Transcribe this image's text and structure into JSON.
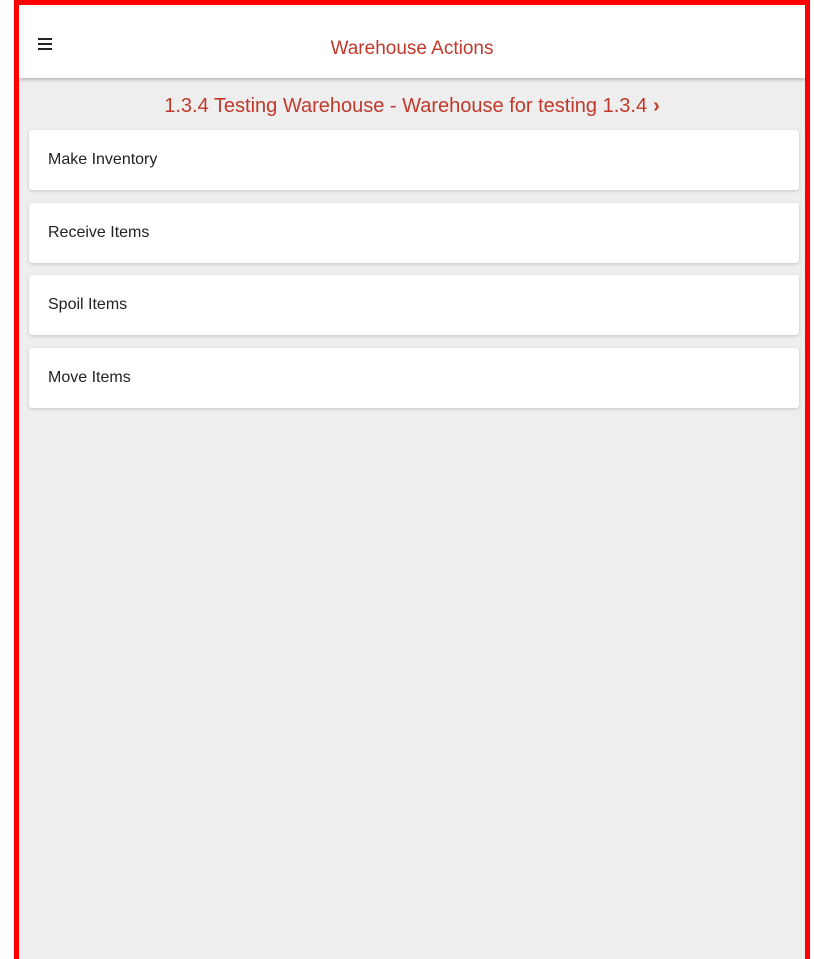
{
  "header": {
    "title": "Warehouse Actions",
    "menu_icon": "hamburger-menu-icon"
  },
  "warehouse": {
    "label": "1.3.4 Testing Warehouse - Warehouse for testing 1.3.4",
    "chevron": "›"
  },
  "actions": [
    {
      "label": "Make Inventory"
    },
    {
      "label": "Receive Items"
    },
    {
      "label": "Spoil Items"
    },
    {
      "label": "Move Items"
    }
  ],
  "colors": {
    "accent": "#c0392b",
    "background": "#eeeeee",
    "frame_border": "#ff0000"
  }
}
